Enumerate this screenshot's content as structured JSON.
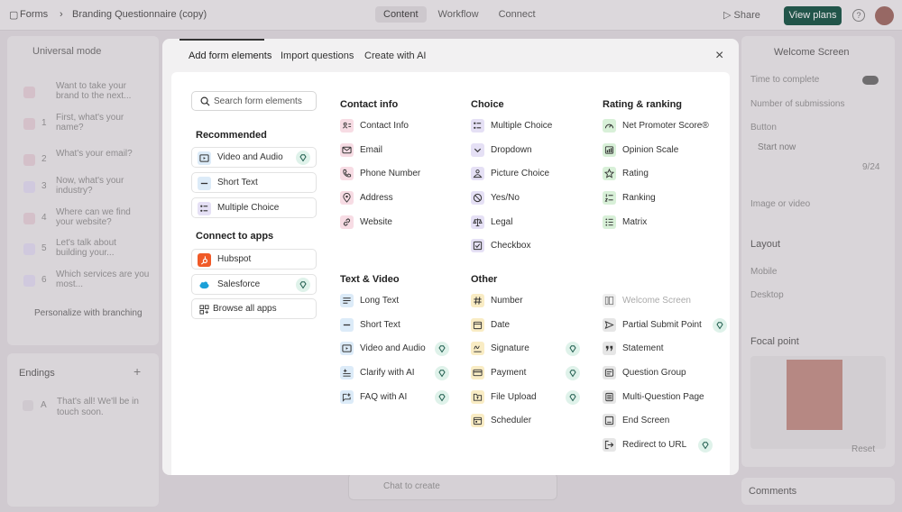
{
  "app": {
    "breadcrumb_root": "Forms",
    "breadcrumb_sep": "›",
    "breadcrumb_current": "Branding Questionnaire (copy)",
    "nav": [
      "Content",
      "Workflow",
      "Connect"
    ],
    "share_label": "Share",
    "view_plans_label": "View plans",
    "help_label": "?"
  },
  "left_panel": {
    "mode_label": "Universal mode",
    "questions": [
      {
        "num": "",
        "text": "Want to take your brand to the next..."
      },
      {
        "num": "1",
        "text": "First, what's your name?"
      },
      {
        "num": "2",
        "text": "What's your email?"
      },
      {
        "num": "3",
        "text": "Now, what's your industry?"
      },
      {
        "num": "4",
        "text": "Where can we find your website?"
      },
      {
        "num": "5",
        "text": "Let's talk about building your..."
      },
      {
        "num": "6",
        "text": "Which services are you most..."
      }
    ],
    "personalize_label": "Personalize with branching",
    "endings_label": "Endings",
    "endings_plus": "+",
    "ending_letter": "A",
    "ending_text": "That's all! We'll be in touch soon."
  },
  "right_panel": {
    "screen_select": "Welcome Screen",
    "time_to_complete": "Time to complete",
    "number_of_submissions": "Number of submissions",
    "button_label": "Button",
    "button_value": "Start now",
    "char_count": "9/24",
    "image_or_video": "Image or video",
    "layout_label": "Layout",
    "mobile_label": "Mobile",
    "desktop_label": "Desktop",
    "focal_point_label": "Focal point",
    "reset_label": "Reset",
    "comments_label": "Comments"
  },
  "chat": {
    "placeholder": "Chat to create"
  },
  "modal": {
    "tabs": [
      "Add form elements",
      "Import questions",
      "Create with AI"
    ],
    "close": "×",
    "search_placeholder": "Search form elements",
    "recommended_title": "Recommended",
    "recommended": [
      "Video and Audio",
      "Short Text",
      "Multiple Choice"
    ],
    "connect_title": "Connect to apps",
    "apps": [
      "Hubspot",
      "Salesforce",
      "Browse all apps"
    ],
    "columns": {
      "contact": {
        "title": "Contact info",
        "items": [
          "Contact Info",
          "Email",
          "Phone Number",
          "Address",
          "Website"
        ]
      },
      "choice": {
        "title": "Choice",
        "items": [
          "Multiple Choice",
          "Dropdown",
          "Picture Choice",
          "Yes/No",
          "Legal",
          "Checkbox"
        ]
      },
      "rating": {
        "title": "Rating & ranking",
        "items": [
          "Net Promoter Score®",
          "Opinion Scale",
          "Rating",
          "Ranking",
          "Matrix"
        ]
      },
      "text_video": {
        "title": "Text & Video",
        "items": [
          "Long Text",
          "Short Text",
          "Video and Audio",
          "Clarify with AI",
          "FAQ with AI"
        ]
      },
      "other": {
        "title": "Other",
        "items": [
          "Number",
          "Date",
          "Signature",
          "Payment",
          "File Upload",
          "Scheduler"
        ]
      },
      "other2": {
        "items": [
          "Welcome Screen",
          "Partial Submit Point",
          "Statement",
          "Question Group",
          "Multi-Question Page",
          "End Screen",
          "Redirect to URL"
        ]
      }
    }
  },
  "colors": {
    "accent": "#1f5c4d",
    "premium_badge": "#dff2ea"
  }
}
